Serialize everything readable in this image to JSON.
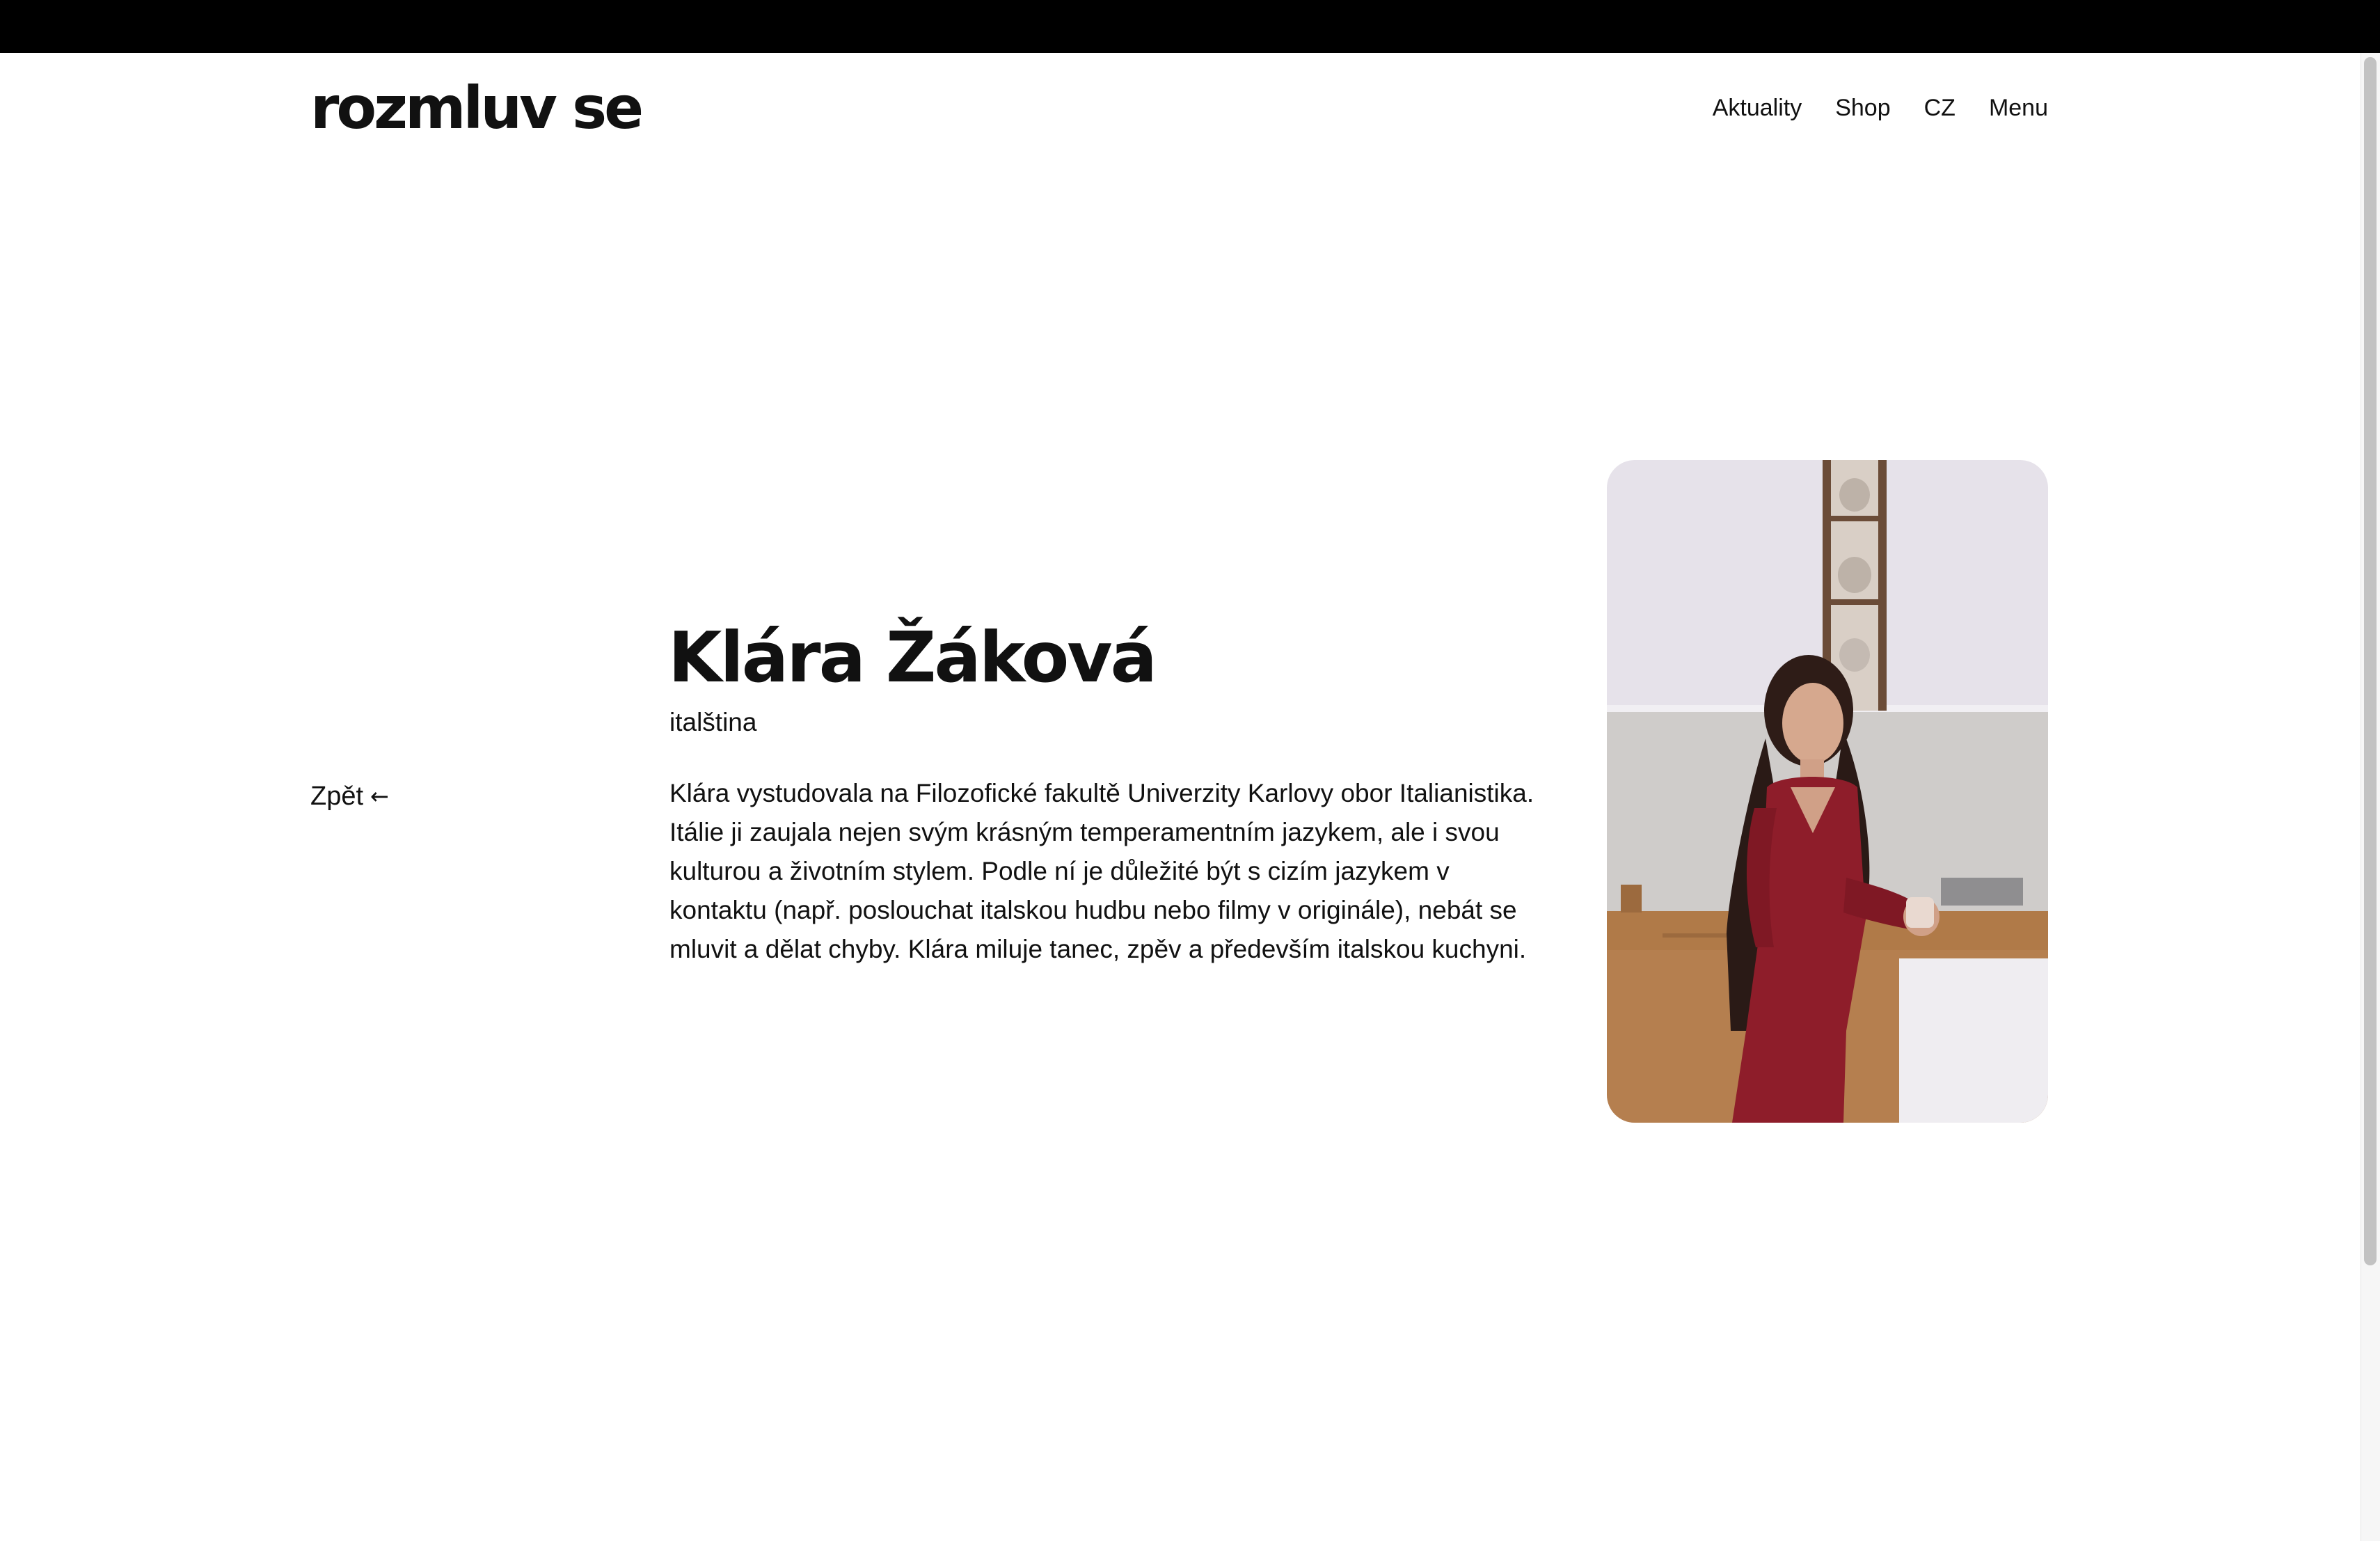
{
  "brand": {
    "logo_text": "rozmluv se"
  },
  "nav": {
    "items": [
      {
        "label": "Aktuality"
      },
      {
        "label": "Shop"
      },
      {
        "label": "CZ"
      },
      {
        "label": "Menu"
      }
    ]
  },
  "back": {
    "label": "Zpět",
    "icon": "arrow-left-icon"
  },
  "profile": {
    "name": "Klára Žáková",
    "subject": "italština",
    "bio": "Klára vystudovala na Filozofické fakultě Univerzity Karlovy obor Italianistika. Itálie ji zaujala nejen svým krásným temperamentním jazykem, ale i svou kulturou a životním stylem. Podle ní je důležité být s cizím jazykem v kontaktu (např. poslouchat italskou hudbu nebo filmy v originále), nebát se mluvit a dělat chyby. Klára miluje tanec, zpěv a především italskou kuchyni."
  },
  "colors": {
    "topbar": "#000000",
    "text": "#111111",
    "dress": "#8e1d2a",
    "wall": "#e6e2ea",
    "counter": "#b07a48"
  }
}
